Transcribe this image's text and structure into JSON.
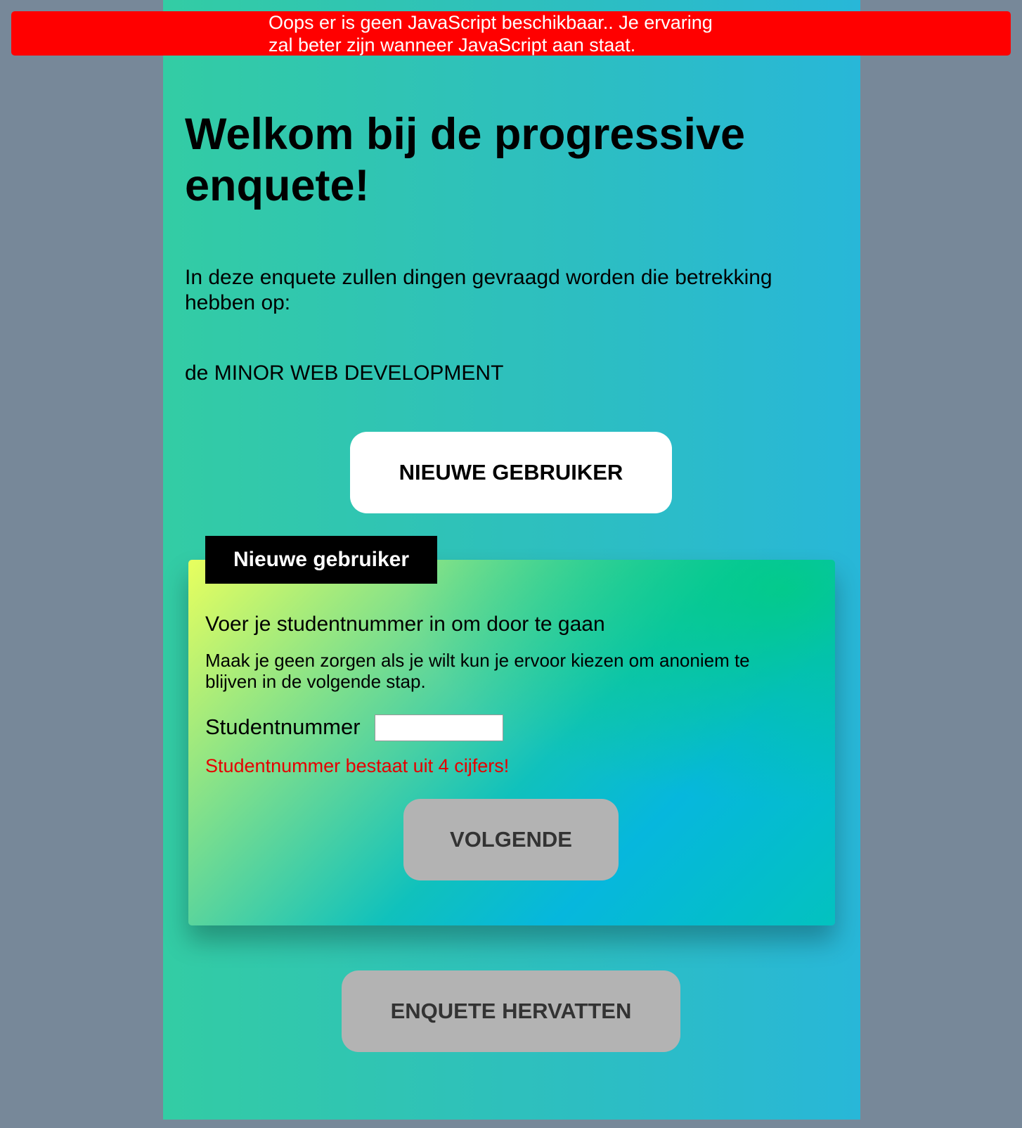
{
  "banner": {
    "line1": "Oops er is geen JavaScript beschikbaar.. Je ervaring",
    "line2": "zal beter zijn wanneer JavaScript aan staat."
  },
  "main": {
    "title": "Welkom bij de progressive enquete!",
    "intro": "In deze enquete zullen dingen gevraagd worden die betrekking hebben op:",
    "topic": "de MINOR WEB DEVELOPMENT",
    "new_user_button": "NIEUWE GEBRUIKER",
    "resume_button": "ENQUETE HERVATTEN"
  },
  "form": {
    "legend": "Nieuwe gebruiker",
    "heading": "Voer je studentnummer in om door te gaan",
    "description": "Maak je geen zorgen als je wilt kun je ervoor kiezen om anoniem te blijven in de volgende stap.",
    "student_label": "Studentnummer",
    "student_value": "",
    "error": "Studentnummer bestaat uit 4 cijfers!",
    "next_button": "VOLGENDE"
  },
  "colors": {
    "banner": "#ff0000",
    "background": "#778899",
    "error_text": "#e60000",
    "legend_bg": "#000000",
    "disabled_button": "#b3b3b3"
  }
}
